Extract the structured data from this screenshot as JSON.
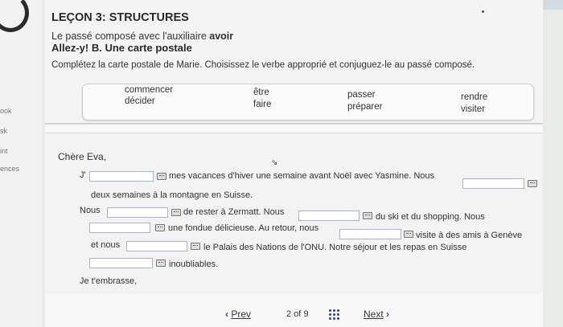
{
  "sidebar": {
    "items": [
      "ook",
      "sk",
      "int",
      "ences"
    ]
  },
  "header": {
    "lesson_title": "LEÇON 3: STRUCTURES",
    "subtitle_prefix": "Le passé composé avec l'auxiliaire ",
    "subtitle_bold": "avoir",
    "activity_title": "Allez-y! B. Une carte postale",
    "instructions": "Complétez la carte postale de Marie. Choisissez le verbe approprié et conjuguez-le au passé composé."
  },
  "verbs": [
    "commencer",
    "décider",
    "être",
    "faire",
    "passer",
    "préparer",
    "rendre",
    "visiter"
  ],
  "letter": {
    "greeting": "Chère Eva,",
    "l1_start": "J'",
    "l1_after": "mes vacances d'hiver une semaine avant Noël avec Yasmine. Nous",
    "l2": "deux semaines à la montagne en Suisse.",
    "l3_start": "Nous",
    "l3_mid": "de rester à Zermatt. Nous",
    "l3_end": "du ski et du shopping. Nous",
    "l4_mid": "une fondue délicieuse. Au retour, nous",
    "l4_end": "visite à des amis à Genève",
    "l5_start": "et nous",
    "l5_end": "le Palais des Nations de l'ONU. Notre séjour et les repas en Suisse",
    "l6_end": "inoubliables.",
    "closing": "Je t'embrasse,"
  },
  "inputs": [
    "",
    "",
    "",
    "",
    "",
    "",
    "",
    "",
    ""
  ],
  "pager": {
    "prev": "Prev",
    "next": "Next",
    "page": "2",
    "of": "of",
    "total": "9"
  },
  "icons": {
    "prev": "chevron-left-icon",
    "next": "chevron-right-icon",
    "grid": "grid-icon",
    "keyboard": "keyboard-icon"
  },
  "colors": {
    "accent": "#2d4d8c",
    "input_border": "#aab5bf"
  }
}
